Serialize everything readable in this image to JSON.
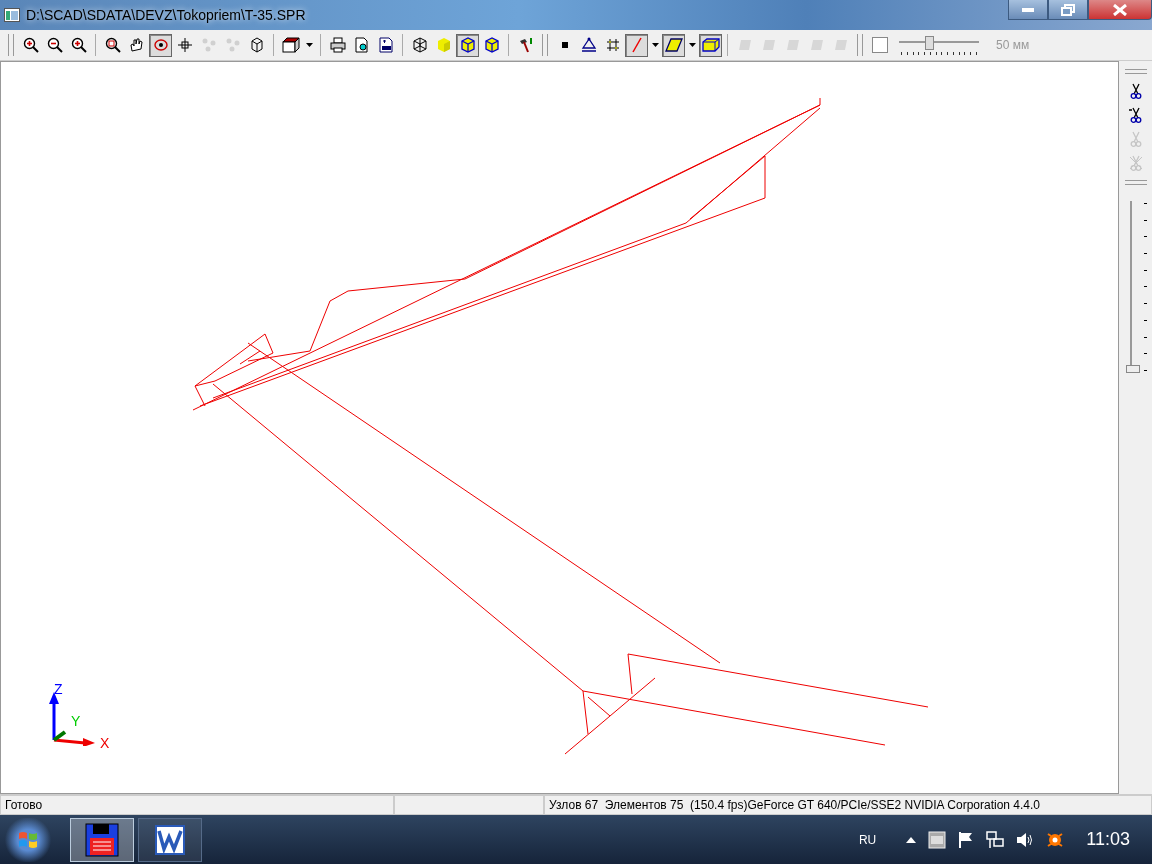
{
  "window": {
    "title": "D:\\SCAD\\SDATA\\DEVZ\\Tokopriem\\T-35.SPR"
  },
  "toolbar": {
    "groups": [
      [
        {
          "kind": "zoom-in",
          "selected": false,
          "disabled": false
        },
        {
          "kind": "zoom-out",
          "selected": false,
          "disabled": false
        },
        {
          "kind": "zoom-all",
          "selected": false,
          "disabled": false
        }
      ],
      [
        {
          "kind": "zoom-window",
          "selected": false,
          "disabled": false
        },
        {
          "kind": "pan",
          "selected": false,
          "disabled": false
        },
        {
          "kind": "rotate",
          "selected": true,
          "disabled": false
        },
        {
          "kind": "crosshair",
          "selected": false,
          "disabled": false
        },
        {
          "kind": "scatter",
          "selected": false,
          "disabled": true
        },
        {
          "kind": "scatter",
          "selected": false,
          "disabled": true
        },
        {
          "kind": "box-outline",
          "selected": false,
          "disabled": false
        }
      ],
      [
        {
          "kind": "red-box",
          "selected": false,
          "disabled": false,
          "dropdown": true
        }
      ],
      [
        {
          "kind": "print",
          "selected": false,
          "disabled": false
        },
        {
          "kind": "preview",
          "selected": false,
          "disabled": false
        },
        {
          "kind": "dxf",
          "selected": false,
          "disabled": false
        }
      ],
      [
        {
          "kind": "wire-cube",
          "selected": false,
          "disabled": false
        },
        {
          "kind": "solid-cube",
          "selected": false,
          "disabled": false
        },
        {
          "kind": "edge-cube",
          "selected": true,
          "disabled": false
        },
        {
          "kind": "edge-cube",
          "selected": false,
          "disabled": false
        }
      ],
      [
        {
          "kind": "hammer",
          "selected": false,
          "disabled": false
        }
      ]
    ],
    "groups2": [
      [
        {
          "kind": "node",
          "selected": false,
          "disabled": false
        },
        {
          "kind": "support",
          "selected": false,
          "disabled": false
        },
        {
          "kind": "grid",
          "selected": false,
          "disabled": false
        },
        {
          "kind": "bar",
          "selected": true,
          "disabled": false,
          "dropdown": true
        },
        {
          "kind": "plate",
          "selected": true,
          "disabled": false,
          "dropdown": true
        },
        {
          "kind": "solid",
          "selected": true,
          "disabled": false
        }
      ],
      [
        {
          "kind": "shape",
          "selected": false,
          "disabled": true
        },
        {
          "kind": "shape",
          "selected": false,
          "disabled": true
        },
        {
          "kind": "shape",
          "selected": false,
          "disabled": true
        },
        {
          "kind": "shape",
          "selected": false,
          "disabled": true
        },
        {
          "kind": "shape",
          "selected": false,
          "disabled": true
        }
      ]
    ],
    "checkbox": {
      "checked": false
    },
    "slider": {
      "level": 0.37,
      "disabled": true
    },
    "slider_reading": "50 мм"
  },
  "side_toolbar": {
    "tools": [
      {
        "kind": "scissors",
        "disabled": false
      },
      {
        "kind": "scissors-dash",
        "disabled": false
      },
      {
        "kind": "scissors",
        "disabled": true
      },
      {
        "kind": "scissors-cross",
        "disabled": true
      }
    ],
    "slider": {
      "level": 0
    }
  },
  "axes": {
    "z": "Z",
    "y": "Y",
    "x": "X"
  },
  "status_bar": {
    "message": "Готово",
    "info": "Узлов 67  Элементов 75  (150.4 fps)GeForce GT 640/PCIe/SSE2 NVIDIA Corporation 4.4.0"
  },
  "taskbar": {
    "tasks": [
      {
        "kind": "floppy",
        "selected": true
      },
      {
        "kind": "word",
        "selected": false
      }
    ],
    "language": "RU",
    "time": "11:03"
  }
}
